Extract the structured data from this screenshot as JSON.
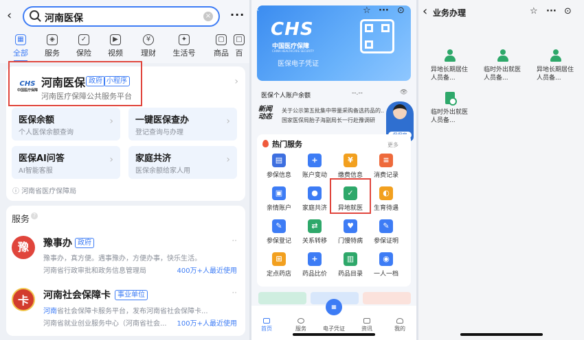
{
  "panel1": {
    "search_query": "河南医保",
    "categories": [
      "全部",
      "服务",
      "保险",
      "视频",
      "理财",
      "生活号",
      "商品",
      "百"
    ],
    "result": {
      "logo_text": "CHS",
      "logo_sub": "中国医疗保障",
      "title": "河南医保",
      "tag_gov": "政府",
      "tag_app": "小程序",
      "subtitle": "河南医疗保障公共服务平台"
    },
    "tiles": [
      {
        "title": "医保余额",
        "sub": "个人医保余额查询"
      },
      {
        "title": "一键医保查办",
        "sub": "登记查询与办理"
      },
      {
        "title": "医保AI问答",
        "sub": "AI智能客服"
      },
      {
        "title": "家庭共济",
        "sub": "医保余额给家人用"
      }
    ],
    "footer": "河南省医疗保障局",
    "services_title": "服务",
    "service1": {
      "logo": "豫",
      "name": "豫事办",
      "tag": "政府",
      "desc": "豫事办，真方便。遇事豫办，方便办事，快乐生活。",
      "org": "河南省行政审批和政务信息管理局",
      "usage": "400万+人最近使用"
    },
    "service2": {
      "logo": "卡",
      "name": "河南社会保障卡",
      "tag": "事业单位",
      "desc_prefix": "河南",
      "desc": "省社会保障卡服务平台，发布河南省社会保障卡...",
      "org": "河南省就业创业服务中心（河南省社会...",
      "usage": "100万+人最近使用"
    }
  },
  "panel2": {
    "logo_text": "CHS",
    "logo_cn": "中国医疗保障",
    "logo_en": "CHINA HEALTHCARE SECURITY",
    "banner_label": "医保电子凭证",
    "account_label": "医保个人账户余额",
    "account_value": "--.--",
    "news_logo": "新闻动态",
    "news1": "关于公示第五批集中带量采购备选药品的...",
    "news2": "国家医保局胎子海副局长一行赴豫调研",
    "avatar_badge": "保保宝",
    "hot_title": "热门服务",
    "hot_more": "更多",
    "services": [
      "参保信息",
      "账户变动",
      "缴费信息",
      "消费记录",
      "亲情账户",
      "家庭共济",
      "异地就医",
      "生育待遇",
      "参保登记",
      "关系转移",
      "门慢特病",
      "参保证明",
      "定点药店",
      "药品比价",
      "药品目录",
      "一人一档"
    ],
    "tabs": [
      "首页",
      "服务",
      "电子凭证",
      "资讯",
      "我的"
    ],
    "colors": {
      "primary": "#3d7cf5",
      "highlight": "#e0453c"
    }
  },
  "panel3": {
    "title": "业务办理",
    "items": [
      {
        "label": "异地长期居住人员备..."
      },
      {
        "label": "临时外出就医人员备..."
      },
      {
        "label": "异地长期居住人员备..."
      },
      {
        "label": "临时外出就医人员备..."
      }
    ]
  }
}
